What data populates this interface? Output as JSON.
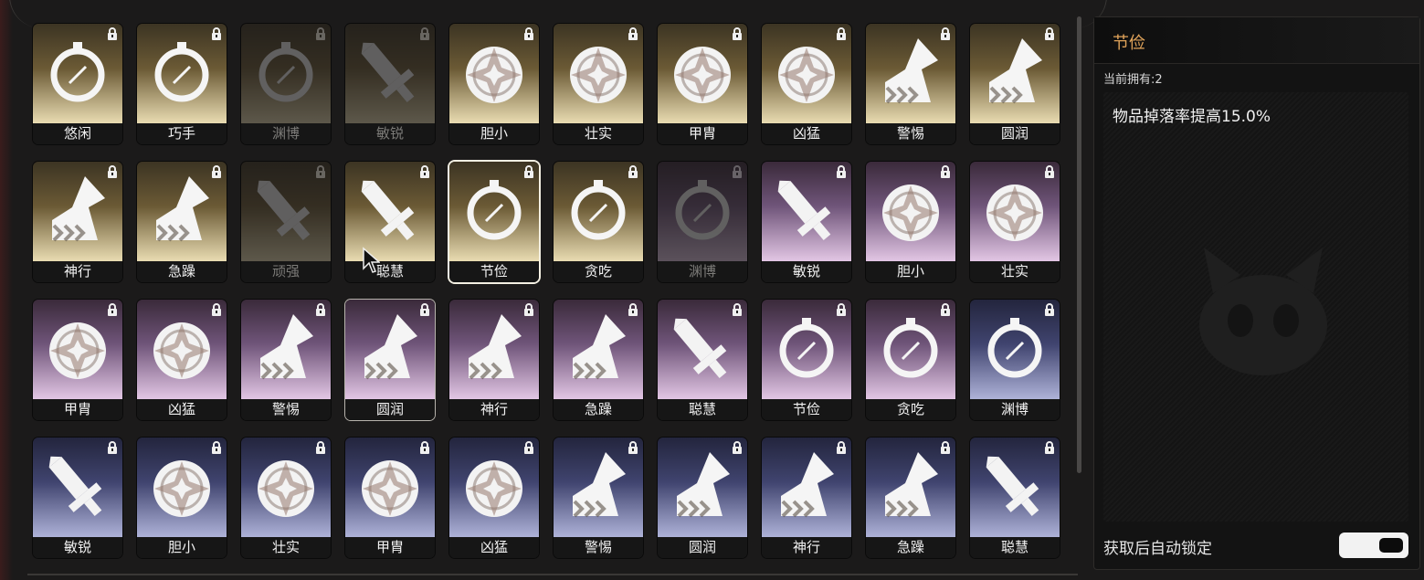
{
  "detail": {
    "title": "节俭",
    "owned": "当前拥有:2",
    "description": "物品掉落率提高15.0%",
    "auto_lock_label": "获取后自动锁定",
    "auto_lock_enabled": true
  },
  "icons": {
    "compass": "compass-icon",
    "star": "star-emblem-icon",
    "sword": "sword-icon",
    "boot": "winged-boot-icon",
    "lock": "lock-icon"
  },
  "colors": {
    "gold": "#e9dcb2",
    "purple": "#e2c6e4",
    "blue": "#aeb2d8",
    "title_accent": "#e0a35a"
  },
  "items": [
    {
      "label": "悠闲",
      "icon": "compass",
      "tier": "gold",
      "dim": false
    },
    {
      "label": "巧手",
      "icon": "compass",
      "tier": "gold",
      "dim": false
    },
    {
      "label": "渊博",
      "icon": "compass",
      "tier": "gold",
      "dim": true
    },
    {
      "label": "敏锐",
      "icon": "sword",
      "tier": "gold",
      "dim": true
    },
    {
      "label": "胆小",
      "icon": "star",
      "tier": "gold",
      "dim": false
    },
    {
      "label": "壮实",
      "icon": "star",
      "tier": "gold",
      "dim": false
    },
    {
      "label": "甲胄",
      "icon": "star",
      "tier": "gold",
      "dim": false
    },
    {
      "label": "凶猛",
      "icon": "star",
      "tier": "gold",
      "dim": false
    },
    {
      "label": "警惕",
      "icon": "boot",
      "tier": "gold",
      "dim": false
    },
    {
      "label": "圆润",
      "icon": "boot",
      "tier": "gold",
      "dim": false
    },
    {
      "label": "神行",
      "icon": "boot",
      "tier": "gold",
      "dim": false
    },
    {
      "label": "急躁",
      "icon": "boot",
      "tier": "gold",
      "dim": false
    },
    {
      "label": "顽强",
      "icon": "sword",
      "tier": "gold",
      "dim": true
    },
    {
      "label": "聪慧",
      "icon": "sword",
      "tier": "gold",
      "dim": false
    },
    {
      "label": "节俭",
      "icon": "compass",
      "tier": "gold",
      "dim": false,
      "selected": true
    },
    {
      "label": "贪吃",
      "icon": "compass",
      "tier": "gold",
      "dim": false
    },
    {
      "label": "渊博",
      "icon": "compass",
      "tier": "purple",
      "dim": true
    },
    {
      "label": "敏锐",
      "icon": "sword",
      "tier": "purple",
      "dim": false
    },
    {
      "label": "胆小",
      "icon": "star",
      "tier": "purple",
      "dim": false
    },
    {
      "label": "壮实",
      "icon": "star",
      "tier": "purple",
      "dim": false
    },
    {
      "label": "甲胄",
      "icon": "star",
      "tier": "purple",
      "dim": false
    },
    {
      "label": "凶猛",
      "icon": "star",
      "tier": "purple",
      "dim": false
    },
    {
      "label": "警惕",
      "icon": "boot",
      "tier": "purple",
      "dim": false
    },
    {
      "label": "圆润",
      "icon": "boot",
      "tier": "purple",
      "dim": false,
      "hover": true
    },
    {
      "label": "神行",
      "icon": "boot",
      "tier": "purple",
      "dim": false
    },
    {
      "label": "急躁",
      "icon": "boot",
      "tier": "purple",
      "dim": false
    },
    {
      "label": "聪慧",
      "icon": "sword",
      "tier": "purple",
      "dim": false
    },
    {
      "label": "节俭",
      "icon": "compass",
      "tier": "purple",
      "dim": false
    },
    {
      "label": "贪吃",
      "icon": "compass",
      "tier": "purple",
      "dim": false
    },
    {
      "label": "渊博",
      "icon": "compass",
      "tier": "blue",
      "dim": false
    },
    {
      "label": "敏锐",
      "icon": "sword",
      "tier": "blue",
      "dim": false
    },
    {
      "label": "胆小",
      "icon": "star",
      "tier": "blue",
      "dim": false
    },
    {
      "label": "壮实",
      "icon": "star",
      "tier": "blue",
      "dim": false
    },
    {
      "label": "甲胄",
      "icon": "star",
      "tier": "blue",
      "dim": false
    },
    {
      "label": "凶猛",
      "icon": "star",
      "tier": "blue",
      "dim": false
    },
    {
      "label": "警惕",
      "icon": "boot",
      "tier": "blue",
      "dim": false
    },
    {
      "label": "圆润",
      "icon": "boot",
      "tier": "blue",
      "dim": false
    },
    {
      "label": "神行",
      "icon": "boot",
      "tier": "blue",
      "dim": false
    },
    {
      "label": "急躁",
      "icon": "boot",
      "tier": "blue",
      "dim": false
    },
    {
      "label": "聪慧",
      "icon": "sword",
      "tier": "blue",
      "dim": false
    }
  ]
}
